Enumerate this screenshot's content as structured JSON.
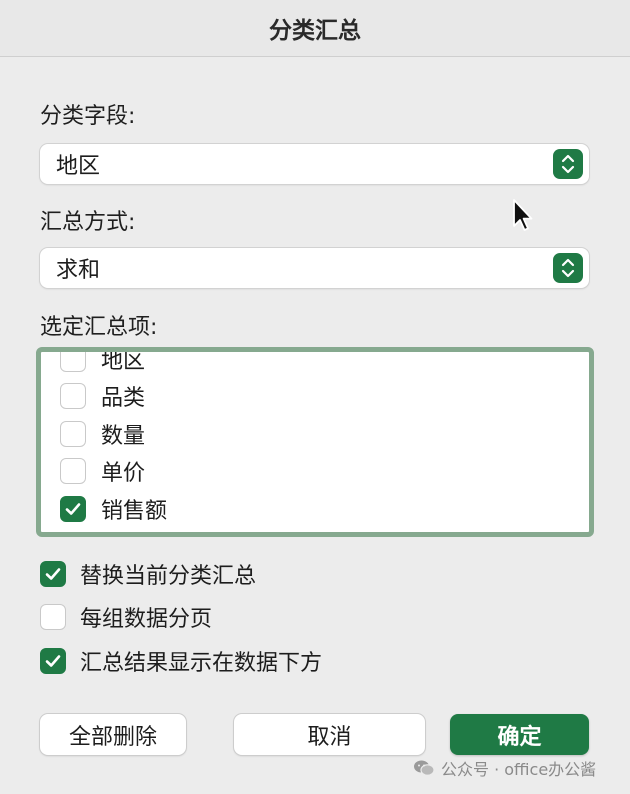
{
  "dialog": {
    "title": "分类汇总"
  },
  "group_by": {
    "label": "分类字段:",
    "value": "地区"
  },
  "function": {
    "label": "汇总方式:",
    "value": "求和"
  },
  "subtotal_items": {
    "label": "选定汇总项:",
    "items": [
      {
        "label": "地区",
        "checked": false
      },
      {
        "label": "品类",
        "checked": false
      },
      {
        "label": "数量",
        "checked": false
      },
      {
        "label": "单价",
        "checked": false
      },
      {
        "label": "销售额",
        "checked": true
      }
    ]
  },
  "options": [
    {
      "label": "替换当前分类汇总",
      "checked": true
    },
    {
      "label": "每组数据分页",
      "checked": false
    },
    {
      "label": "汇总结果显示在数据下方",
      "checked": true
    }
  ],
  "buttons": {
    "remove_all": "全部删除",
    "cancel": "取消",
    "ok": "确定"
  },
  "watermark": {
    "text": "公众号 · office办公酱"
  },
  "colors": {
    "accent": "#1f7a45",
    "list_focus_ring": "#86a98f"
  }
}
